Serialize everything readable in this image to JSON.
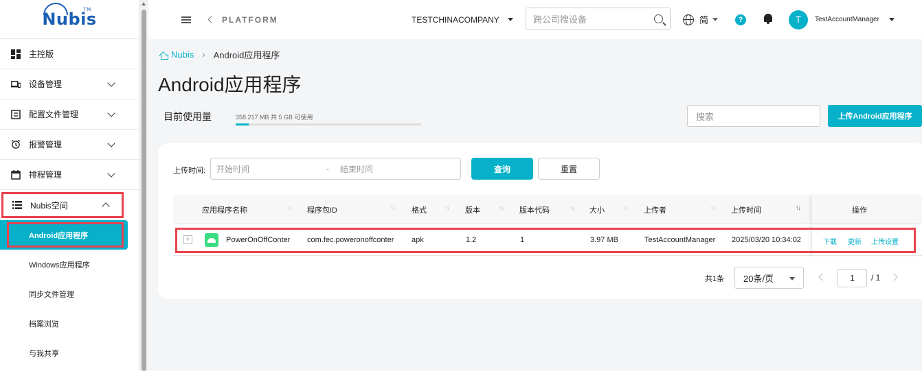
{
  "brand": {
    "logo_text": "Nubis",
    "logo_tm": "TM"
  },
  "sidebar": {
    "items": [
      {
        "label": "主控版",
        "icon": "dashboard-icon"
      },
      {
        "label": "设备管理",
        "icon": "devices-icon"
      },
      {
        "label": "配置文件管理",
        "icon": "profile-icon"
      },
      {
        "label": "报警管理",
        "icon": "alarm-icon"
      },
      {
        "label": "排程管理",
        "icon": "calendar-icon"
      },
      {
        "label": "Nubis空间",
        "icon": "list-icon"
      }
    ],
    "subitems": [
      {
        "label": "Android应用程序",
        "active": true
      },
      {
        "label": "Windows应用程序"
      },
      {
        "label": "同步文件管理"
      },
      {
        "label": "档案浏览"
      },
      {
        "label": "与我共享"
      }
    ]
  },
  "header": {
    "platform": "PLATFORM",
    "company": "TESTCHINACOMPANY",
    "search_placeholder": "跨公司搜设备",
    "lang": "简",
    "help": "?",
    "avatar_initial": "T",
    "user": "TestAccountManager"
  },
  "breadcrumb": {
    "home": "Nubis",
    "separator": "›",
    "current": "Android应用程序"
  },
  "page": {
    "title": "Android应用程序",
    "usage_label": "目前使用量",
    "usage_text": "358.217 MB 共 5 GB 可使用",
    "usage_fraction": 0.07,
    "search_placeholder": "搜索",
    "upload_button": "上传Android应用程序"
  },
  "filter": {
    "time_label": "上传时间:",
    "start_placeholder": "开始时间",
    "dash": "-",
    "end_placeholder": "结束时间",
    "query_button": "查询",
    "reset_button": "重置"
  },
  "table": {
    "columns": [
      "应用程序名称",
      "程序包ID",
      "格式",
      "版本",
      "版本代码",
      "大小",
      "上传者",
      "上传时间",
      "操作"
    ],
    "sort_glyph": "↑↓",
    "rows": [
      {
        "expand": "+",
        "name": "PowerOnOffConter",
        "package": "com.fec.poweronoffconter",
        "format": "apk",
        "version": "1.2",
        "version_code": "1",
        "size": "3.97 MB",
        "uploader": "TestAccountManager",
        "upload_time": "2025/03/20 10:34:02",
        "actions": [
          "下載",
          "更新",
          "上传设置"
        ]
      }
    ]
  },
  "pager": {
    "total": "共1条",
    "page_size": "20条/页",
    "current_page": "1",
    "of": "/ 1"
  },
  "colors": {
    "accent": "#06b1c9",
    "highlight": "#e8424f"
  }
}
